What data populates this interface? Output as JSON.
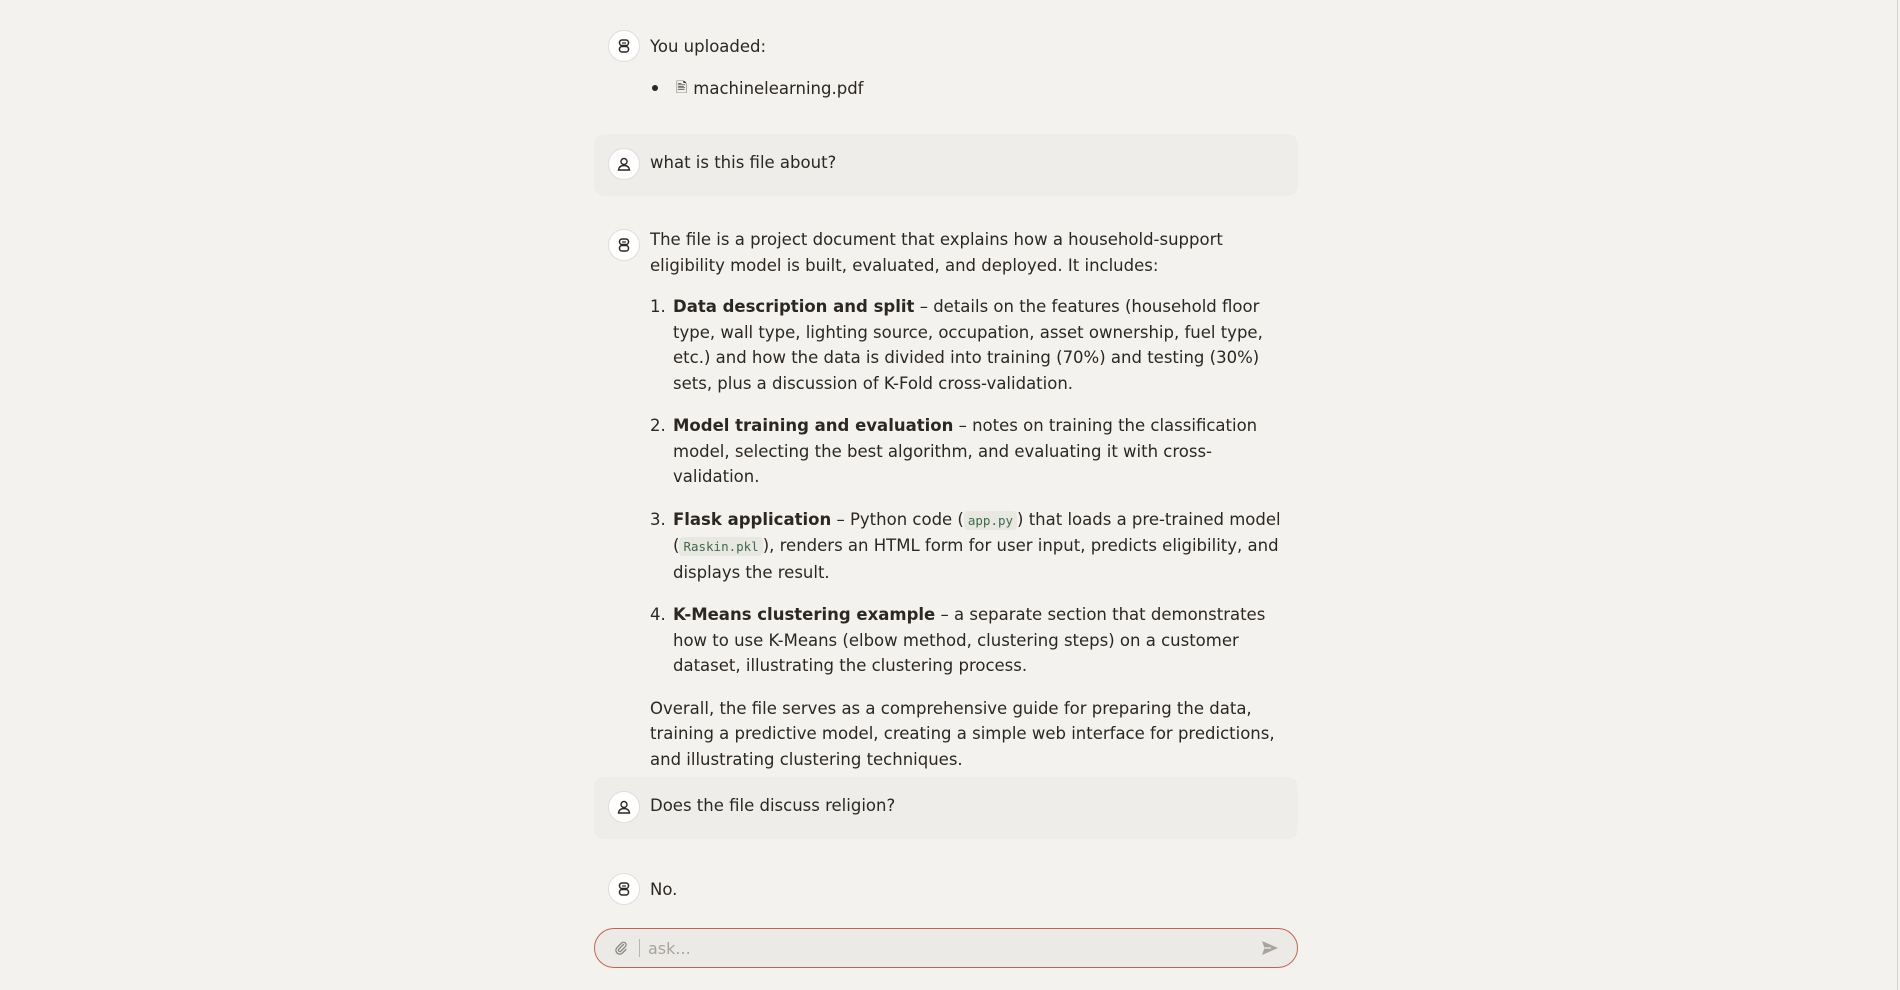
{
  "conversation": {
    "upload": {
      "label": "You uploaded:",
      "file_name": "machinelearning.pdf",
      "file_icon": "document-icon"
    },
    "q1": {
      "text": "what is this file about?"
    },
    "a1": {
      "intro": "The file is a project document that explains how a household-support eligibility model is built, evaluated, and deployed. It includes:",
      "items": [
        {
          "num": "1.",
          "title": "Data description and split",
          "text": " – details on the features (household floor type, wall type, lighting source, occupation, asset ownership, fuel type, etc.) and how the data is divided into training (70%) and testing (30%) sets, plus a discussion of K-Fold cross-validation."
        },
        {
          "num": "2.",
          "title": "Model training and evaluation",
          "text": " – notes on training the classification model, selecting the best algorithm, and evaluating it with cross-validation."
        },
        {
          "num": "3.",
          "title": "Flask application",
          "text_a": " – Python code (",
          "code_a": "app.py",
          "text_b": ") that loads a pre-trained model (",
          "code_b": "Raskin.pkl",
          "text_c": "), renders an HTML form for user input, predicts eligibility, and displays the result."
        },
        {
          "num": "4.",
          "title": "K-Means clustering example",
          "text": " – a separate section that demonstrates how to use K-Means (elbow method, clustering steps) on a customer dataset, illustrating the clustering process."
        }
      ],
      "summary": "Overall, the file serves as a comprehensive guide for preparing the data, training a predictive model, creating a simple web interface for predictions, and illustrating clustering techniques."
    },
    "q2": {
      "text": "Does the file discuss religion?"
    },
    "a2": {
      "text": "No."
    }
  },
  "input": {
    "placeholder": "ask...",
    "value": ""
  },
  "icons": {
    "assistant": "bot-icon",
    "user": "user-icon",
    "attach": "paperclip-icon",
    "send": "send-icon"
  },
  "colors": {
    "background": "#f4f2ee",
    "user_bubble": "#eeedea",
    "input_border": "#c5634f",
    "code_text": "#3d6b49"
  }
}
